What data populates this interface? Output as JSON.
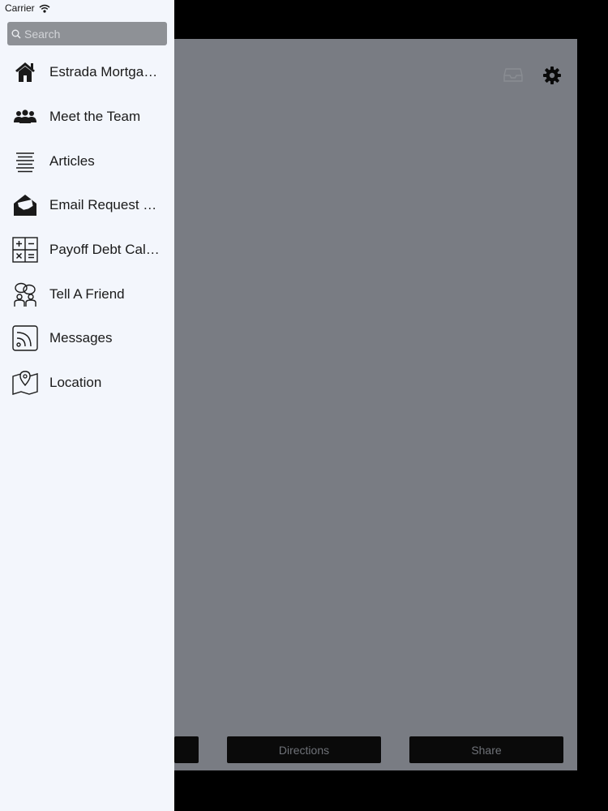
{
  "status_bar": {
    "carrier": "Carrier",
    "wifi_icon": "wifi-icon"
  },
  "search": {
    "placeholder": "Search",
    "value": "",
    "icon": "search-icon"
  },
  "menu": {
    "items": [
      {
        "label": "Estrada Mortgage Team",
        "icon": "home-icon"
      },
      {
        "label": "Meet the Team",
        "icon": "people-icon"
      },
      {
        "label": "Articles",
        "icon": "article-lines-icon"
      },
      {
        "label": "Email Request Quote",
        "icon": "open-envelope-icon"
      },
      {
        "label": "Payoff Debt Calculator",
        "icon": "calculator-icon"
      },
      {
        "label": "Tell A Friend",
        "icon": "tell-friend-icon"
      },
      {
        "label": "Messages",
        "icon": "rss-feed-icon"
      },
      {
        "label": "Location",
        "icon": "map-pin-icon"
      }
    ]
  },
  "app": {
    "top_icons": [
      "inbox-icon",
      "gear-icon"
    ],
    "buttons": {
      "directions": "Directions",
      "share": "Share"
    }
  },
  "colors": {
    "drawer_bg": "#f3f6fc",
    "search_bg": "#8e9196",
    "dim_panel": "#797c83",
    "button_bg": "#0a0a0a"
  }
}
